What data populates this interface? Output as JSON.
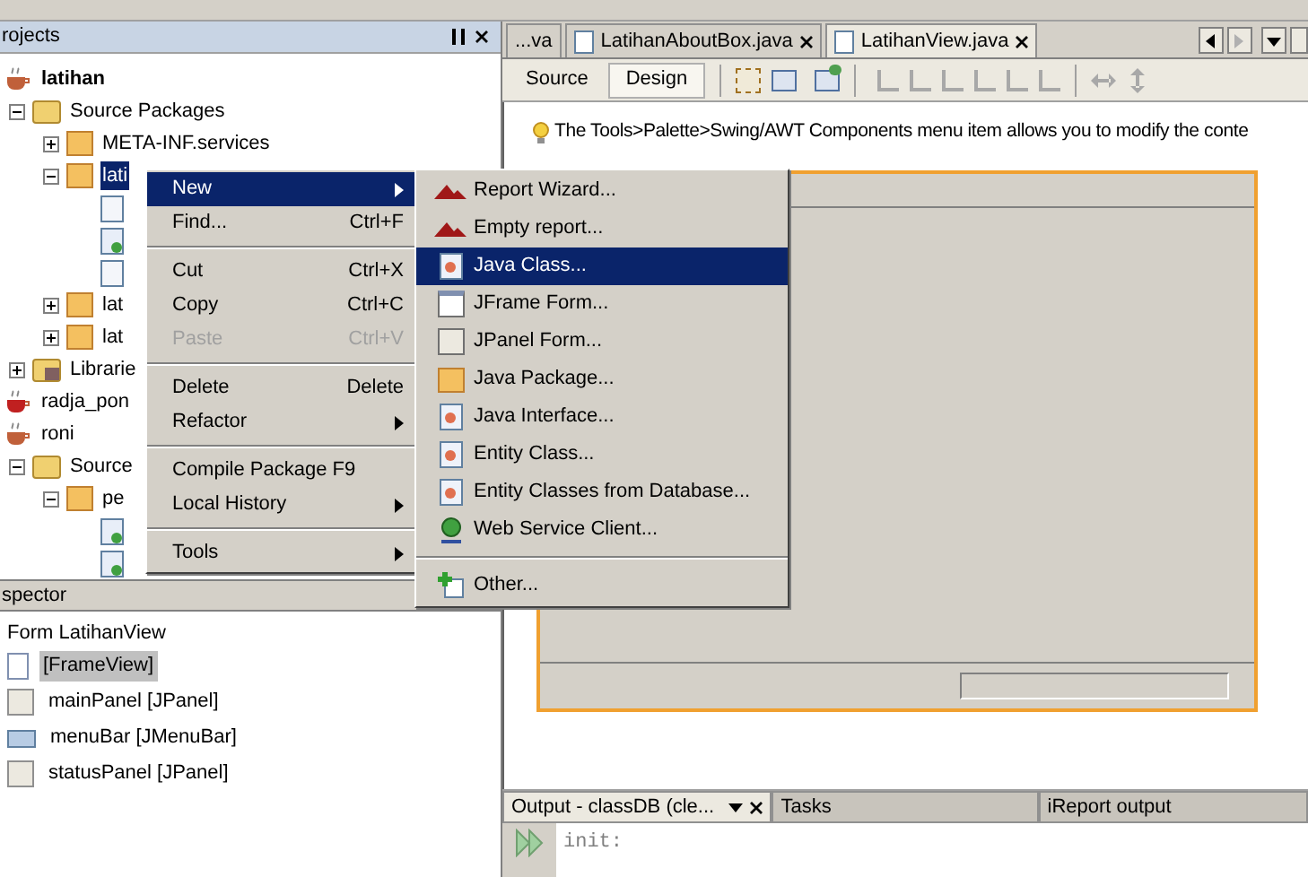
{
  "projects_panel": {
    "title": "rojects",
    "tree": [
      {
        "label": "latihan",
        "kind": "project",
        "main_project": true,
        "selected": false,
        "children": [
          {
            "label": "Source Packages",
            "kind": "folder",
            "expanded": true,
            "selected": false,
            "children": [
              {
                "label": "META-INF.services",
                "kind": "package",
                "expanded": false,
                "selected": false
              },
              {
                "label": "lati",
                "kind": "package",
                "expanded": true,
                "selected": true,
                "children": [
                  {
                    "kind": "file",
                    "selected": false
                  },
                  {
                    "kind": "form",
                    "selected": false
                  },
                  {
                    "kind": "file",
                    "selected": false
                  }
                ]
              },
              {
                "label": "lat",
                "kind": "package",
                "expanded": false,
                "selected": false
              },
              {
                "label": "lat",
                "kind": "package",
                "expanded": false,
                "selected": false
              }
            ]
          },
          {
            "label": "Librarie",
            "kind": "library",
            "expanded": false,
            "selected": false
          }
        ]
      },
      {
        "label": "radja_pon",
        "kind": "project-error",
        "main_project": false,
        "selected": false
      },
      {
        "label": "roni",
        "kind": "project",
        "main_project": false,
        "selected": false,
        "children": [
          {
            "label": "Source",
            "kind": "folder",
            "expanded": true,
            "selected": false,
            "children": [
              {
                "label": "pe",
                "kind": "package",
                "expanded": true,
                "selected": false,
                "children": [
                  {
                    "kind": "form",
                    "selected": false
                  },
                  {
                    "kind": "form",
                    "selected": false
                  }
                ]
              }
            ]
          }
        ]
      }
    ]
  },
  "inspector_panel": {
    "title": "spector",
    "root": "Form LatihanView",
    "items": [
      {
        "label": "[FrameView]",
        "kind": "frame",
        "selected": true
      },
      {
        "label": "mainPanel [JPanel]",
        "kind": "panel",
        "selected": false
      },
      {
        "label": "menuBar [JMenuBar]",
        "kind": "menubar",
        "selected": false
      },
      {
        "label": "statusPanel [JPanel]",
        "kind": "panel",
        "selected": false
      }
    ]
  },
  "editor_tabs": [
    {
      "label": "...va",
      "selected": false,
      "closable": false
    },
    {
      "label": "LatihanAboutBox.java",
      "selected": false,
      "closable": true
    },
    {
      "label": "LatihanView.java",
      "selected": true,
      "closable": true
    }
  ],
  "view_toggle": [
    {
      "label": "Source",
      "selected": false
    },
    {
      "label": "Design",
      "selected": true
    }
  ],
  "hint": "The Tools>Palette>Swing/AWT Components menu item allows you to modify the conte",
  "context_menu": [
    {
      "label": "New",
      "kind": "submenu",
      "selected": true,
      "disabled": false
    },
    {
      "label": "Find...",
      "shortcut": "Ctrl+F",
      "kind": "item",
      "selected": false,
      "disabled": false
    },
    {
      "kind": "separator"
    },
    {
      "label": "Cut",
      "shortcut": "Ctrl+X",
      "kind": "item",
      "selected": false,
      "disabled": false
    },
    {
      "label": "Copy",
      "shortcut": "Ctrl+C",
      "kind": "item",
      "selected": false,
      "disabled": false
    },
    {
      "label": "Paste",
      "shortcut": "Ctrl+V",
      "kind": "item",
      "selected": false,
      "disabled": true
    },
    {
      "kind": "separator"
    },
    {
      "label": "Delete",
      "shortcut": "Delete",
      "kind": "item",
      "selected": false,
      "disabled": false
    },
    {
      "label": "Refactor",
      "kind": "submenu",
      "selected": false,
      "disabled": false
    },
    {
      "kind": "separator"
    },
    {
      "label": "Compile Package F9",
      "kind": "item",
      "selected": false,
      "disabled": false
    },
    {
      "label": "Local History",
      "kind": "submenu",
      "selected": false,
      "disabled": false
    },
    {
      "kind": "separator"
    },
    {
      "label": "Tools",
      "kind": "submenu",
      "selected": false,
      "disabled": false
    }
  ],
  "new_submenu": [
    {
      "label": "Report Wizard...",
      "kind": "report",
      "selected": false
    },
    {
      "label": "Empty report...",
      "kind": "report",
      "selected": false
    },
    {
      "label": "Java Class...",
      "kind": "class",
      "selected": true
    },
    {
      "label": "JFrame Form...",
      "kind": "frame",
      "selected": false
    },
    {
      "label": "JPanel Form...",
      "kind": "panel",
      "selected": false
    },
    {
      "label": "Java Package...",
      "kind": "package",
      "selected": false
    },
    {
      "label": "Java Interface...",
      "kind": "class",
      "selected": false
    },
    {
      "label": "Entity Class...",
      "kind": "class",
      "selected": false
    },
    {
      "label": "Entity Classes from Database...",
      "kind": "class",
      "selected": false
    },
    {
      "label": "Web Service Client...",
      "kind": "globe",
      "selected": false
    },
    {
      "kind": "separator"
    },
    {
      "label": "Other...",
      "kind": "other",
      "selected": false
    }
  ],
  "output_tabs": [
    {
      "label": "Output - classDB (cle...",
      "selected": true
    },
    {
      "label": "Tasks",
      "selected": false
    },
    {
      "label": "iReport output",
      "selected": false
    }
  ],
  "output_text": "init:"
}
